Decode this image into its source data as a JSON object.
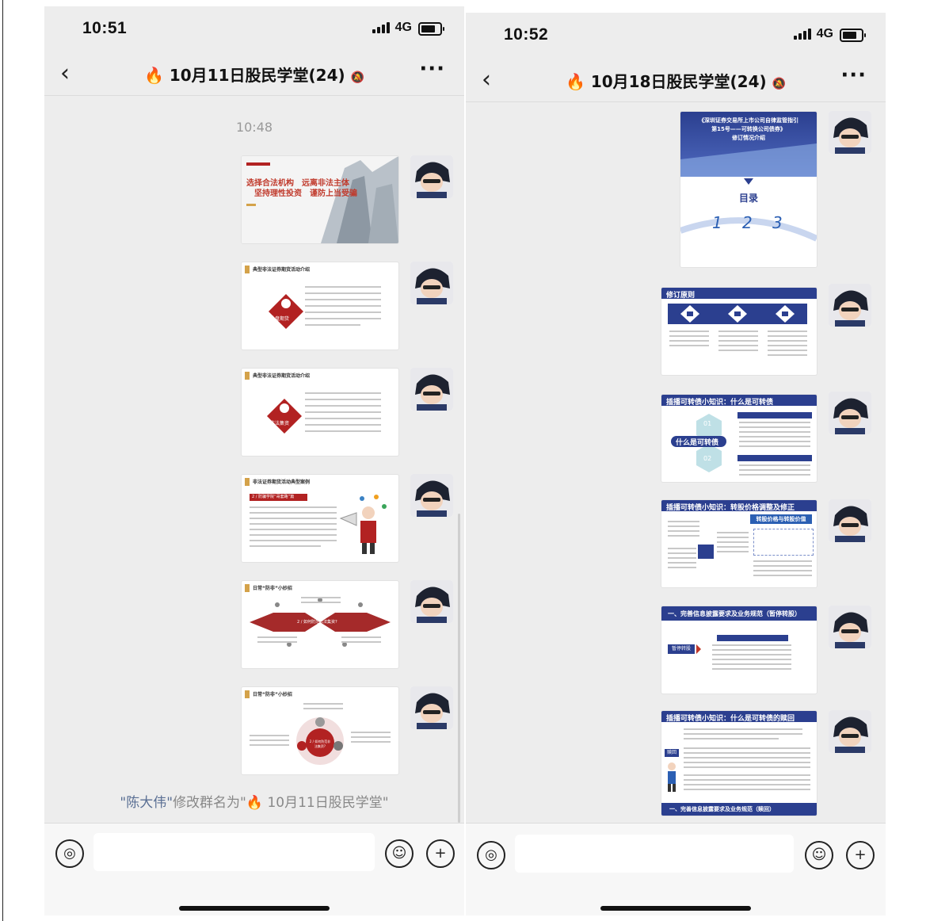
{
  "screens": [
    {
      "status_time": "10:51",
      "network": "4G",
      "chat_title": "10月11日股民学堂(24)",
      "timestamp": "10:48",
      "system_message": {
        "who": "\"陈大伟\"",
        "action": "修改群名为\"",
        "new_name": "10月11日股民学堂\""
      },
      "slides": [
        {
          "headline1": "选择合法机构　远离非法主体",
          "headline2": "坚持理性投资　谨防上当受骗"
        },
        {
          "header": "典型非法证券期货活动介绍",
          "badge": "外盘期货"
        },
        {
          "header": "典型非法证券期货活动介绍",
          "badge": "非法集资"
        },
        {
          "header": "非法证券期货活动典型案例",
          "banner": "2 / 防骗学院“哥套路”篇"
        },
        {
          "header": "日常“防非”小妙招",
          "banner": "2 / 如何防范非法集资?"
        },
        {
          "header": "日常“防非”小妙招",
          "badge": "2 / 如何防范非法集资?"
        }
      ]
    },
    {
      "status_time": "10:52",
      "network": "4G",
      "chat_title": "10月18日股民学堂(24)",
      "slides": [
        {
          "title1": "《深圳证券交易所上市公司自律监管指引",
          "title2": "第15号——可转换公司债券》",
          "title3": "修订情况介绍",
          "toc": "目录",
          "nums": [
            "1",
            "2",
            "3"
          ]
        },
        {
          "header": "修订原则"
        },
        {
          "header": "插播可转债小知识：什么是可转债",
          "center": "什么是可转债",
          "n1": "01",
          "n2": "02"
        },
        {
          "header": "插播可转债小知识：转股价格调整及修正",
          "banner": "转股价格与转股价值"
        },
        {
          "header": "一、完善信息披露要求及业务规范（暂停转股）",
          "tag": "暂停转股"
        },
        {
          "header": "插播可转债小知识：什么是可转债的赎回",
          "tag": "赎回",
          "footer": "一、完善信息披露要求及业务规范（赎回）"
        }
      ]
    }
  ]
}
